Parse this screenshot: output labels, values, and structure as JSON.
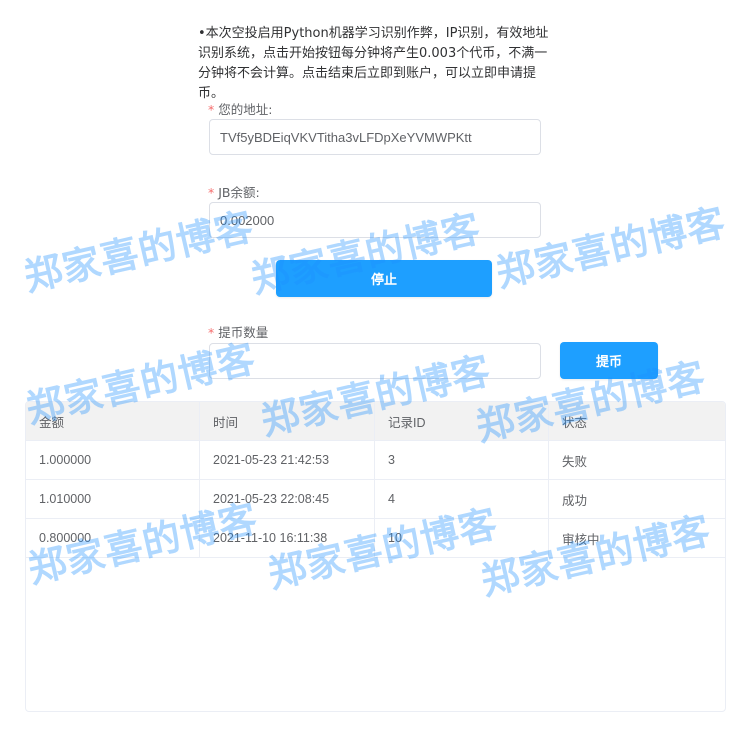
{
  "notice": "•本次空投启用Python机器学习识别作弊，IP识别，有效地址识别系统，点击开始按钮每分钟将产生0.003个代币，不满一分钟将不会计算。点击结束后立即到账户，可以立即申请提币。",
  "form": {
    "required_mark": "*",
    "address": {
      "label": "您的地址:",
      "value": "TVf5yBDEiqVKVTitha3vLFDpXeYVMWPKtt"
    },
    "balance": {
      "label": "JB余额:",
      "value": "0.002000"
    },
    "stop_button": "停止",
    "withdraw_amount": {
      "label": "提币数量",
      "value": "",
      "placeholder": ""
    },
    "withdraw_button": "提币"
  },
  "table": {
    "headers": [
      "金额",
      "时间",
      "记录ID",
      "状态"
    ],
    "rows": [
      [
        "1.000000",
        "2021-05-23 21:42:53",
        "3",
        "失败"
      ],
      [
        "1.010000",
        "2021-05-23 22:08:45",
        "4",
        "成功"
      ],
      [
        "0.800000",
        "2021-11-10 16:11:38",
        "10",
        "审核中"
      ]
    ]
  },
  "watermark": "郑家喜的博客",
  "colors": {
    "primary": "#1e9fff",
    "required": "#f56c6c",
    "watermark": "#1e90ff"
  }
}
